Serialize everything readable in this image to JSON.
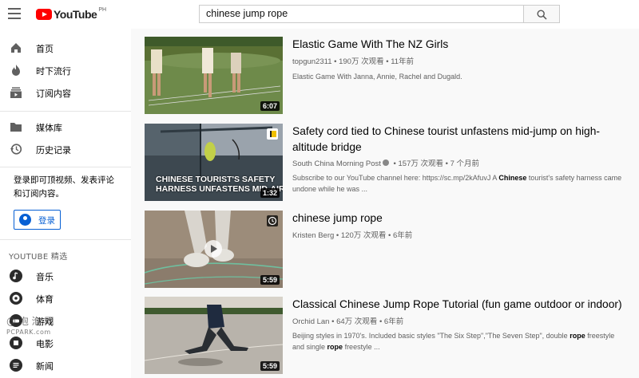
{
  "header": {
    "logo_text": "YouTube",
    "region": "PH",
    "search_value": "chinese jump rope"
  },
  "sidebar": {
    "main": [
      {
        "label": "首页",
        "icon": "home-icon"
      },
      {
        "label": "时下流行",
        "icon": "fire-icon"
      },
      {
        "label": "订阅内容",
        "icon": "subscriptions-icon"
      }
    ],
    "library": [
      {
        "label": "媒体库",
        "icon": "folder-icon"
      },
      {
        "label": "历史记录",
        "icon": "history-icon"
      }
    ],
    "signin_prompt": "登录即可顶视频、发表评论和订阅内容。",
    "login_label": "登录",
    "best_of_title": "YOUTUBE 精选",
    "best_of": [
      {
        "label": "音乐",
        "icon": "music-icon"
      },
      {
        "label": "体育",
        "icon": "sports-icon"
      },
      {
        "label": "游戏",
        "icon": "gaming-icon"
      },
      {
        "label": "电影",
        "icon": "movies-icon"
      },
      {
        "label": "新闻",
        "icon": "news-icon"
      }
    ]
  },
  "videos": [
    {
      "title": "Elastic Game With The NZ Girls",
      "channel": "topgun2311",
      "views": "190万 次观看",
      "age": "11年前",
      "duration": "6:07",
      "description": "Elastic Game With Janna, Annie, Rachel and Dugald."
    },
    {
      "title": "Safety cord tied to Chinese tourist unfastens mid-jump on high-altitude bridge",
      "channel": "South China Morning Post",
      "views": "157万 次观看",
      "age": "7 个月前",
      "duration": "1:32",
      "thumb_caption_1": "CHINESE TOURIST'S SAFETY",
      "thumb_caption_2": "HARNESS UNFASTENS MID-AIR",
      "desc_a": "Subscribe to our YouTube channel here: https://sc.mp/2kAfuvJ A ",
      "desc_b": "Chinese",
      "desc_c": " tourist's safety harness came undone while he was ..."
    },
    {
      "title": "chinese jump rope",
      "channel": "Kristen Berg",
      "views": "120万 次观看",
      "age": "6年前",
      "duration": "5:59"
    },
    {
      "title": "Classical Chinese Jump Rope Tutorial (fun game outdoor or indoor)",
      "channel": "Orchid Lan",
      "views": "64万 次观看",
      "age": "6年前",
      "duration": "5:59",
      "desc_a": "Beijing styles in 1970's. Included basic styles \"The Six Step\",\"The Seven Step\", double ",
      "desc_b": "rope",
      "desc_c": " freestyle and single ",
      "desc_d": "rope",
      "desc_e": " freestyle ..."
    }
  ],
  "watermark": {
    "line1": "@ 泡 泡 网",
    "line2": "PCPARK.com"
  },
  "colors": {
    "brand_red": "#ff0000",
    "link_blue": "#065fd4"
  }
}
